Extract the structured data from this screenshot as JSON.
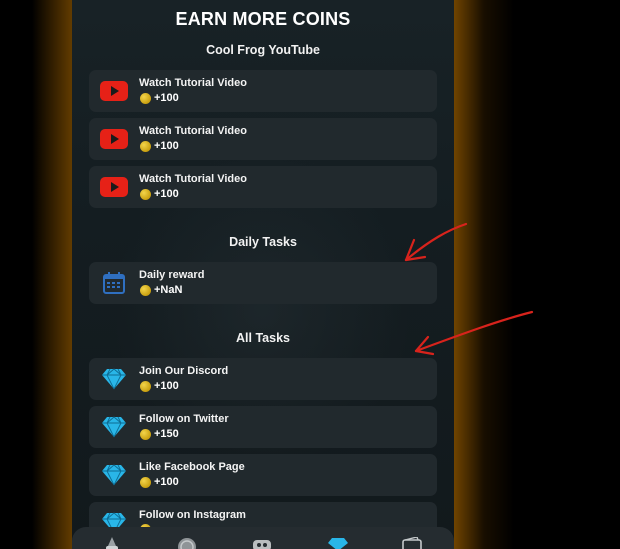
{
  "header": {
    "title": "EARN MORE COINS"
  },
  "sections": {
    "youtube": "Cool Frog YouTube",
    "daily": "Daily Tasks",
    "all": "All Tasks"
  },
  "youtube_tasks": [
    {
      "label": "Watch Tutorial Video",
      "reward": "+100",
      "icon": "youtube-icon"
    },
    {
      "label": "Watch Tutorial Video",
      "reward": "+100",
      "icon": "youtube-icon"
    },
    {
      "label": "Watch Tutorial Video",
      "reward": "+100",
      "icon": "youtube-icon"
    }
  ],
  "daily_tasks": [
    {
      "label": "Daily reward",
      "reward": "+NaN",
      "icon": "calendar-icon"
    }
  ],
  "all_tasks": [
    {
      "label": "Join Our Discord",
      "reward": "+100",
      "icon": "diamond-icon"
    },
    {
      "label": "Follow on Twitter",
      "reward": "+150",
      "icon": "diamond-icon"
    },
    {
      "label": "Like Facebook Page",
      "reward": "+100",
      "icon": "diamond-icon"
    },
    {
      "label": "Follow on Instagram",
      "reward": "",
      "icon": "diamond-icon"
    }
  ],
  "nav": [
    "wizard-icon",
    "coin-icon",
    "friends-icon",
    "diamond-icon",
    "wallet-icon"
  ],
  "colors": {
    "youtube": "#e62117",
    "diamond": "#29b6e8",
    "calendar": "#2f6fc0",
    "coin": "#d9b41c",
    "annotation": "#d8231c"
  }
}
